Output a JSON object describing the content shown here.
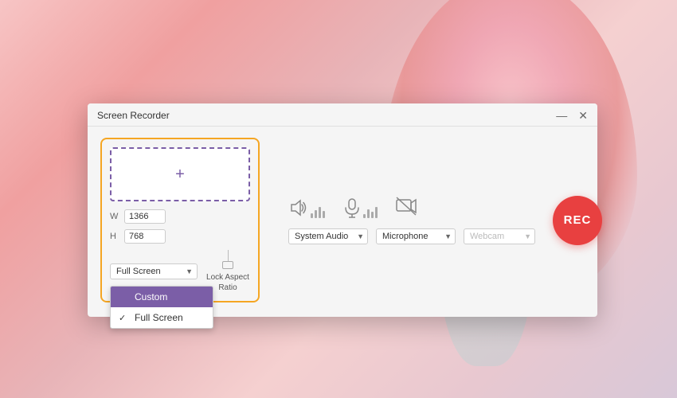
{
  "background": {
    "color_from": "#f7c5c5",
    "color_to": "#d8c8d8"
  },
  "window": {
    "title": "Screen Recorder",
    "controls": {
      "minimize": "—",
      "close": "✕"
    }
  },
  "screen_section": {
    "width_label": "W",
    "height_label": "H",
    "width_value": "1366",
    "height_value": "768",
    "plus_icon": "+",
    "dropdown_value": "Full Screen",
    "dropdown_options": [
      "Custom",
      "Full Screen"
    ],
    "lock_label": "Lock Aspect\nRatio"
  },
  "dropdown_menu": {
    "items": [
      {
        "label": "Custom",
        "active": true,
        "checked": false
      },
      {
        "label": "Full Screen",
        "active": false,
        "checked": true
      }
    ]
  },
  "audio": {
    "system_audio_label": "System Audio",
    "microphone_label": "Microphone",
    "webcam_label": "Webcam"
  },
  "rec_button": {
    "label": "REC"
  }
}
